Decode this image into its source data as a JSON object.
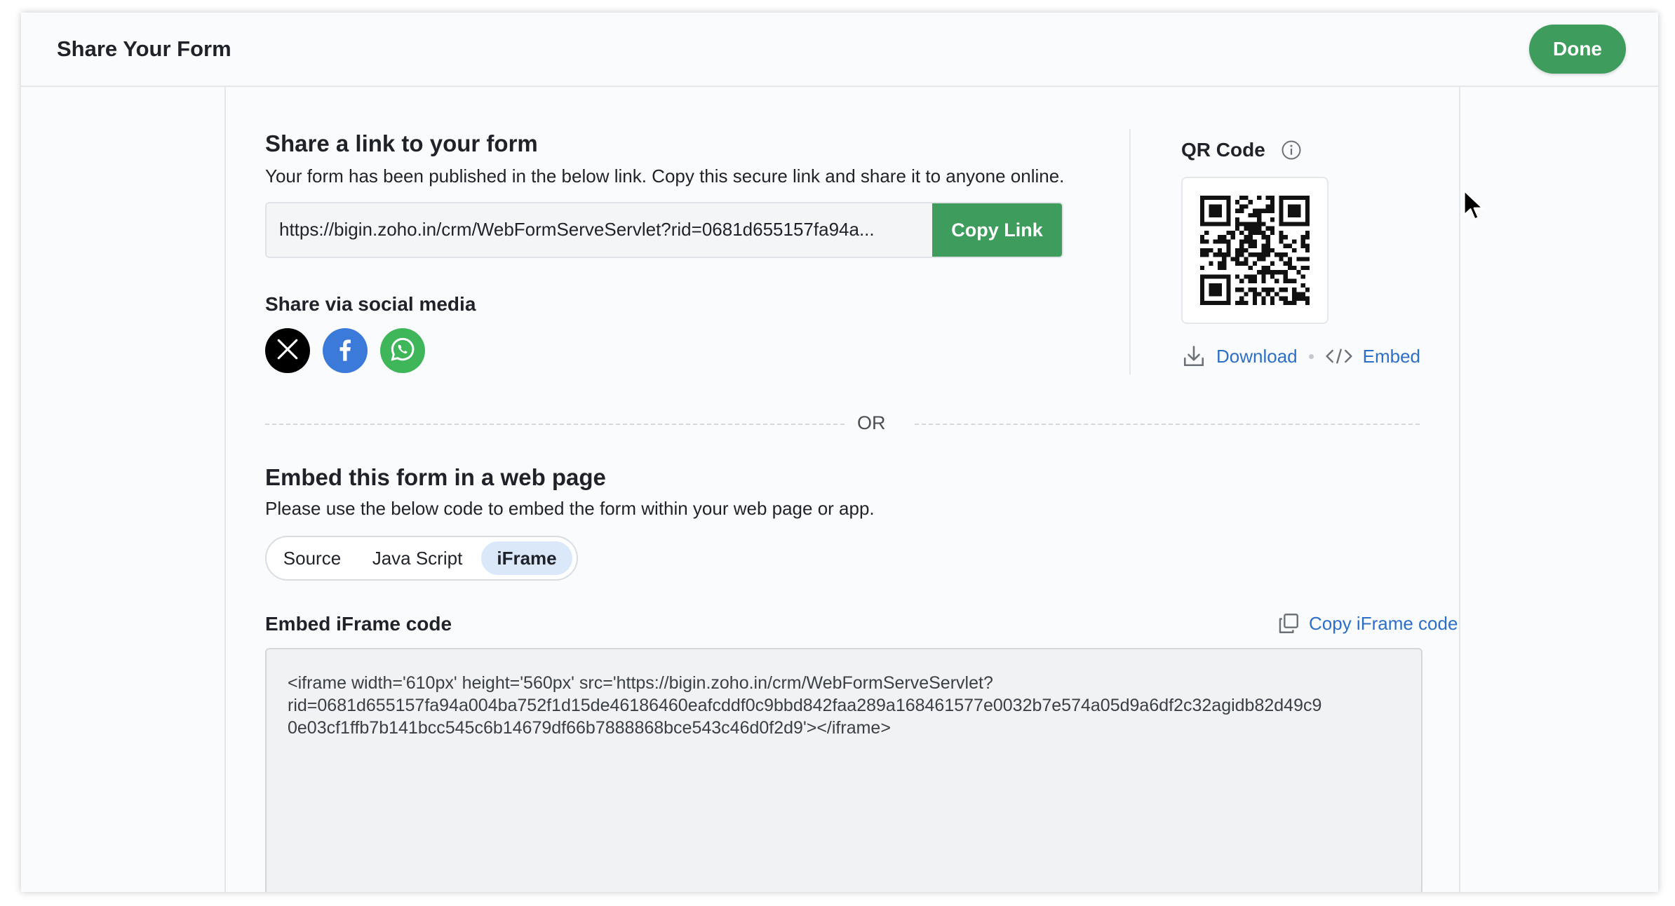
{
  "header": {
    "title": "Share Your Form",
    "done_label": "Done"
  },
  "share_link": {
    "heading": "Share a link to your form",
    "description": "Your form has been published in the below link. Copy this secure link and share it to anyone online.",
    "url": "https://bigin.zoho.in/crm/WebFormServeServlet?rid=0681d655157fa94a...",
    "copy_label": "Copy Link"
  },
  "social": {
    "heading": "Share via social media",
    "items": [
      {
        "name": "x-icon",
        "color": "#000000"
      },
      {
        "name": "facebook-icon",
        "color": "#3b7ad9"
      },
      {
        "name": "whatsapp-icon",
        "color": "#3fb65a"
      }
    ]
  },
  "qr": {
    "heading": "QR Code",
    "download_label": "Download",
    "embed_label": "Embed"
  },
  "divider": {
    "label": "OR"
  },
  "embed": {
    "heading": "Embed this form in a web page",
    "description": "Please use the below code to embed the form within your web page or app.",
    "tabs": [
      "Source",
      "Java Script",
      "iFrame"
    ],
    "active_tab": "iFrame",
    "code_heading": "Embed iFrame code",
    "copy_code_label": "Copy iFrame code",
    "code_lines": [
      "<iframe width='610px' height='560px' src='https://bigin.zoho.in/crm/WebFormServeServlet?",
      "rid=0681d655157fa94a004ba752f1d15de46186460eafcddf0c9bbd842faa289a168461577e0032b7e574a05d9a6df2c32agidb82d49c9",
      "0e03cf1ffb7b141bcc545c6b14679df66b7888868bce543c46d0f2d9'></iframe>"
    ]
  },
  "colors": {
    "accent_green": "#3e9d5d",
    "link_blue": "#2d6fc7",
    "tab_active_bg": "#dbe8fa"
  }
}
